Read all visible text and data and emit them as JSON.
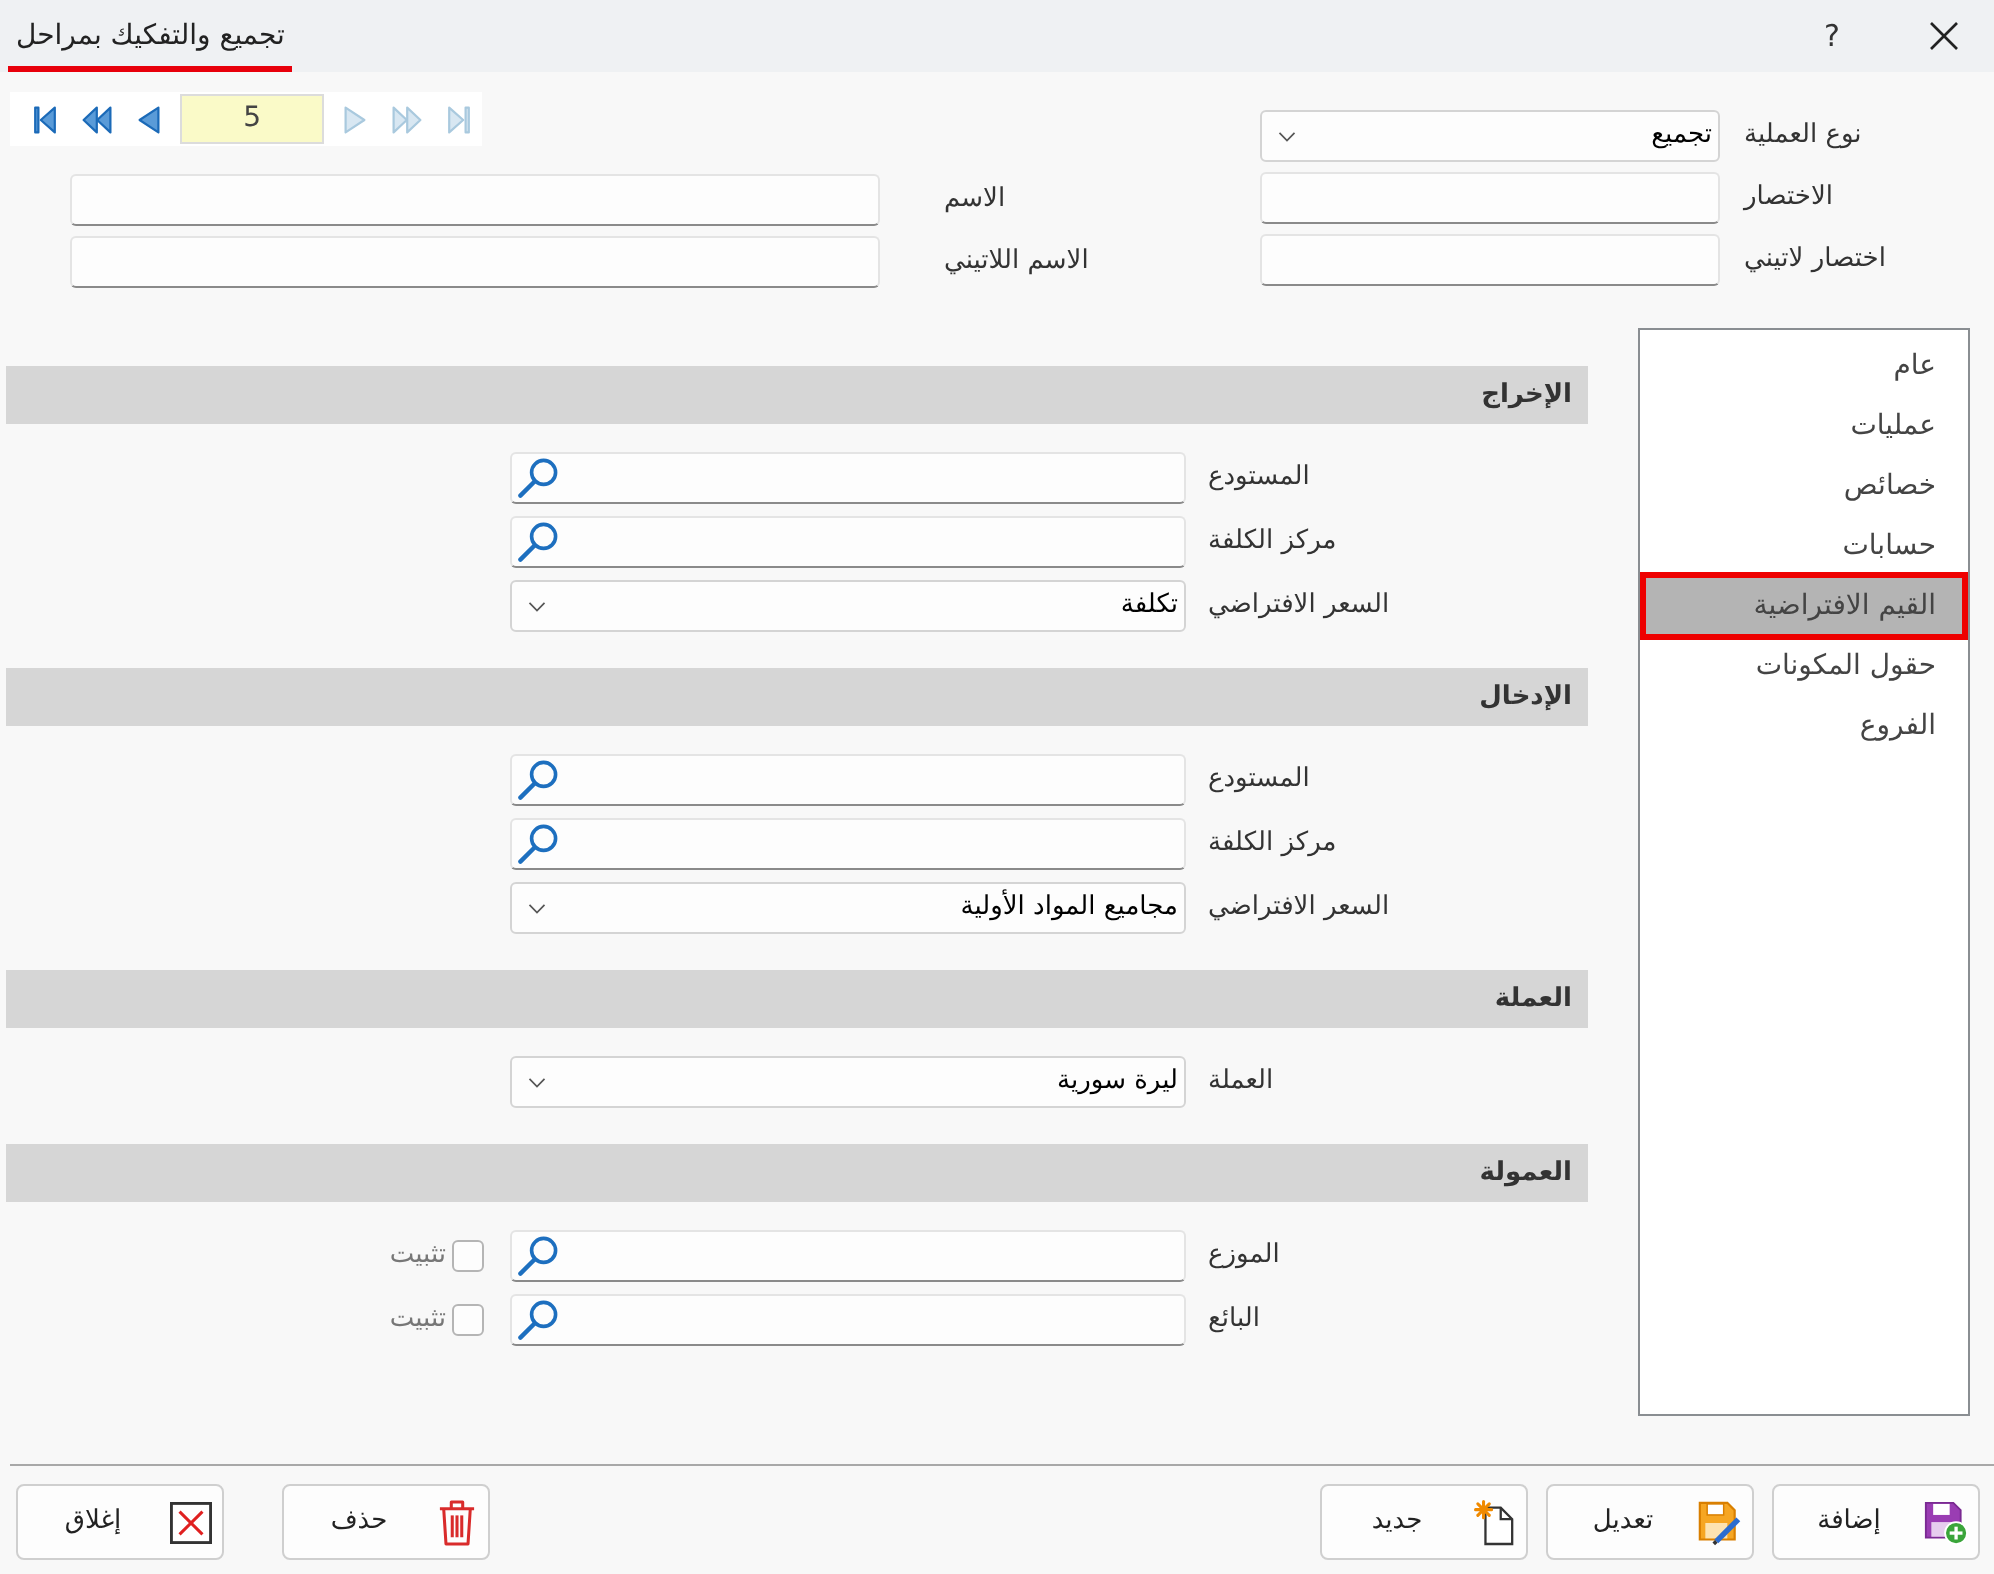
{
  "window": {
    "title": "تجميع والتفكيك بمراحل",
    "help": "?"
  },
  "navigator": {
    "back_buttons": [
      {
        "kind": "first",
        "disabled": false
      },
      {
        "kind": "fast_back",
        "disabled": false
      },
      {
        "kind": "back",
        "disabled": false
      }
    ],
    "record": "5",
    "forward_buttons": [
      {
        "kind": "forward",
        "disabled": true
      },
      {
        "kind": "fast_forward",
        "disabled": true
      },
      {
        "kind": "last",
        "disabled": true
      }
    ]
  },
  "header": {
    "right_fields": [
      {
        "label": "نوع العملية",
        "kind": "select",
        "value": "تجميع"
      },
      {
        "label": "الاختصار",
        "kind": "text"
      },
      {
        "label": "اختصار لاتيني",
        "kind": "text"
      }
    ],
    "left_fields": [
      {
        "label": "الاسم",
        "kind": "text"
      },
      {
        "label": "الاسم اللاتيني",
        "kind": "text"
      }
    ]
  },
  "sidebar": {
    "items": [
      {
        "label": "عام",
        "selected": false
      },
      {
        "label": "عمليات",
        "selected": false
      },
      {
        "label": "خصائص",
        "selected": false
      },
      {
        "label": "حسابات",
        "selected": false
      },
      {
        "label": "القيم الافتراضية",
        "selected": true
      },
      {
        "label": "حقول المكونات",
        "selected": false
      },
      {
        "label": "الفروع",
        "selected": false
      }
    ]
  },
  "sections": [
    {
      "title": "الإخراج",
      "fields": [
        {
          "label": "المستودع",
          "kind": "lookup"
        },
        {
          "label": "مركز الكلفة",
          "kind": "lookup"
        },
        {
          "label": "السعر الافتراضي",
          "kind": "select",
          "value": "تكلفة"
        }
      ]
    },
    {
      "title": "الإدخال",
      "fields": [
        {
          "label": "المستودع",
          "kind": "lookup"
        },
        {
          "label": "مركز الكلفة",
          "kind": "lookup"
        },
        {
          "label": "السعر الافتراضي",
          "kind": "select",
          "value": "مجاميع المواد الأولية"
        }
      ]
    },
    {
      "title": "العملة",
      "fields": [
        {
          "label": "العملة",
          "kind": "select",
          "value": "ليرة سورية"
        }
      ]
    },
    {
      "title": "العمولة",
      "fields": [
        {
          "label": "الموزع",
          "kind": "lookup",
          "pin": {
            "label": "تثبيت",
            "checked": false
          }
        },
        {
          "label": "البائع",
          "kind": "lookup",
          "pin": {
            "label": "تثبيت",
            "checked": false
          }
        }
      ]
    }
  ],
  "footer": {
    "right_buttons": [
      {
        "kind": "add",
        "label": "إضافة"
      },
      {
        "kind": "edit",
        "label": "تعديل"
      },
      {
        "kind": "new",
        "label": "جديد"
      }
    ],
    "left_buttons": [
      {
        "kind": "delete",
        "label": "حذف"
      },
      {
        "kind": "close",
        "label": "إغلاق"
      }
    ]
  }
}
